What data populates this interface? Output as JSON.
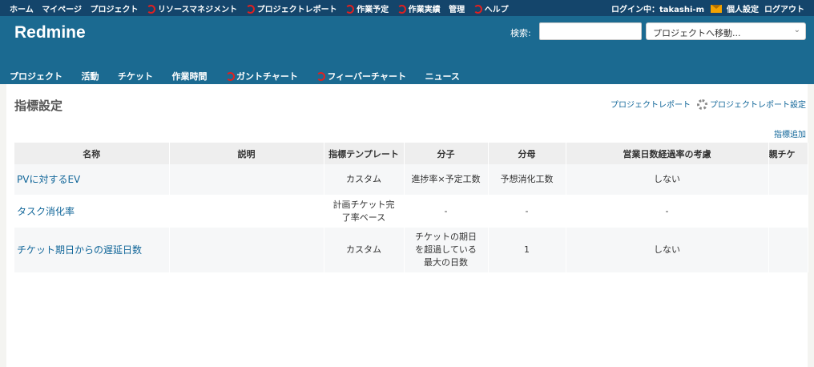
{
  "top_menu": {
    "items": [
      {
        "label": "ホーム",
        "plugin": false
      },
      {
        "label": "マイページ",
        "plugin": false
      },
      {
        "label": "プロジェクト",
        "plugin": false
      },
      {
        "label": "リソースマネジメント",
        "plugin": true
      },
      {
        "label": "プロジェクトレポート",
        "plugin": true
      },
      {
        "label": "作業予定",
        "plugin": true
      },
      {
        "label": "作業実績",
        "plugin": true
      },
      {
        "label": "管理",
        "plugin": false
      },
      {
        "label": "ヘルプ",
        "plugin": true
      }
    ],
    "login_label": "ログイン中：",
    "user": "takashi-m",
    "my_account": "個人設定",
    "logout": "ログアウト"
  },
  "header": {
    "title": "Redmine",
    "search_label": "検索:",
    "search_value": "",
    "jump_label": "プロジェクトへ移動..."
  },
  "main_menu": [
    {
      "label": "プロジェクト",
      "plugin": false
    },
    {
      "label": "活動",
      "plugin": false
    },
    {
      "label": "チケット",
      "plugin": false
    },
    {
      "label": "作業時間",
      "plugin": false
    },
    {
      "label": "ガントチャート",
      "plugin": true
    },
    {
      "label": "フィーバーチャート",
      "plugin": true
    },
    {
      "label": "ニュース",
      "plugin": false
    }
  ],
  "page": {
    "title": "指標設定",
    "links": {
      "project_report": "プロジェクトレポート",
      "project_report_settings": "プロジェクトレポート設定"
    },
    "add_link": "指標追加"
  },
  "table": {
    "headers": [
      "名称",
      "説明",
      "指標テンプレート",
      "分子",
      "分母",
      "営業日数経過率の考慮",
      "親チケ"
    ],
    "rows": [
      {
        "name": "PVに対するEV",
        "description": "",
        "template": "カスタム",
        "numerator": "進捗率×予定工数",
        "denominator": "予想消化工数",
        "business_days": "しない",
        "parent": ""
      },
      {
        "name": "タスク消化率",
        "description": "",
        "template": "計画チケット完了率ベース",
        "numerator": "-",
        "denominator": "-",
        "business_days": "-",
        "parent": ""
      },
      {
        "name": "チケット期日からの遅延日数",
        "description": "",
        "template": "カスタム",
        "numerator": "チケットの期日を超過している最大の日数",
        "denominator": "1",
        "business_days": "しない",
        "parent": ""
      }
    ]
  },
  "colors": {
    "top_bar": "#14456b",
    "header": "#1b6a91",
    "link": "#116699",
    "plugin_icon": "#e02020"
  }
}
